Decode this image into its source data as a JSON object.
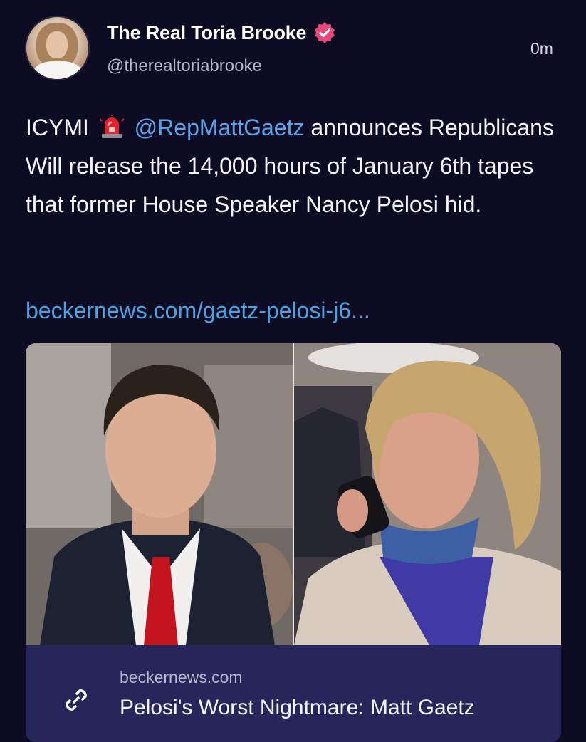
{
  "post": {
    "display_name": "The Real Toria Brooke",
    "handle": "@therealtoriabrooke",
    "time": "0m",
    "text_prefix": "ICYMI",
    "mention": "@RepMattGaetz",
    "text_after_mention": " announces Republicans Will release the 14,000 hours of January 6th tapes that former House Speaker Nancy Pelosi hid.",
    "link": "beckernews.com/gaetz-pelosi-j6..."
  },
  "card": {
    "domain": "beckernews.com",
    "headline": "Pelosi's Worst Nightmare: Matt Gaetz"
  },
  "icons": {
    "verified": "verified-badge-icon",
    "siren": "police-light-emoji-icon",
    "link": "link-icon"
  },
  "colors": {
    "background": "#0d0c22",
    "mention": "#5aa3ea",
    "link": "#4aa2e2",
    "verified": "#e8477a",
    "card_footer": "#26265b"
  }
}
